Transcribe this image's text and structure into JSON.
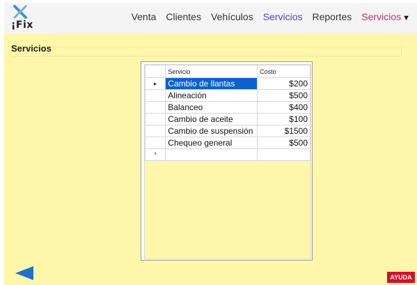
{
  "app": {
    "logo": "¡Fix"
  },
  "nav": {
    "items": [
      "Venta",
      "Clientes",
      "Vehículos",
      "Servicios",
      "Reportes"
    ],
    "dropdown": "Servicios"
  },
  "section": {
    "title": "Servicios"
  },
  "table": {
    "headers": {
      "servicio": "Servicio",
      "costo": "Costo"
    },
    "current_row_marker": "▸",
    "new_row_marker": "*",
    "rows": [
      {
        "servicio": "Cambio de llantas",
        "costo": "$200"
      },
      {
        "servicio": "Alineación",
        "costo": "$500"
      },
      {
        "servicio": "Balanceo",
        "costo": "$400"
      },
      {
        "servicio": "Cambio de aceite",
        "costo": "$100"
      },
      {
        "servicio": "Cambio de suspensión",
        "costo": "$1500"
      },
      {
        "servicio": "Chequeo general",
        "costo": "$500"
      }
    ]
  },
  "footer": {
    "help": "AYUDA"
  },
  "colors": {
    "background": "#fef7a9",
    "selected": "#0a62d0",
    "back_arrow": "#1f6fd6",
    "help": "#d80f2c"
  }
}
